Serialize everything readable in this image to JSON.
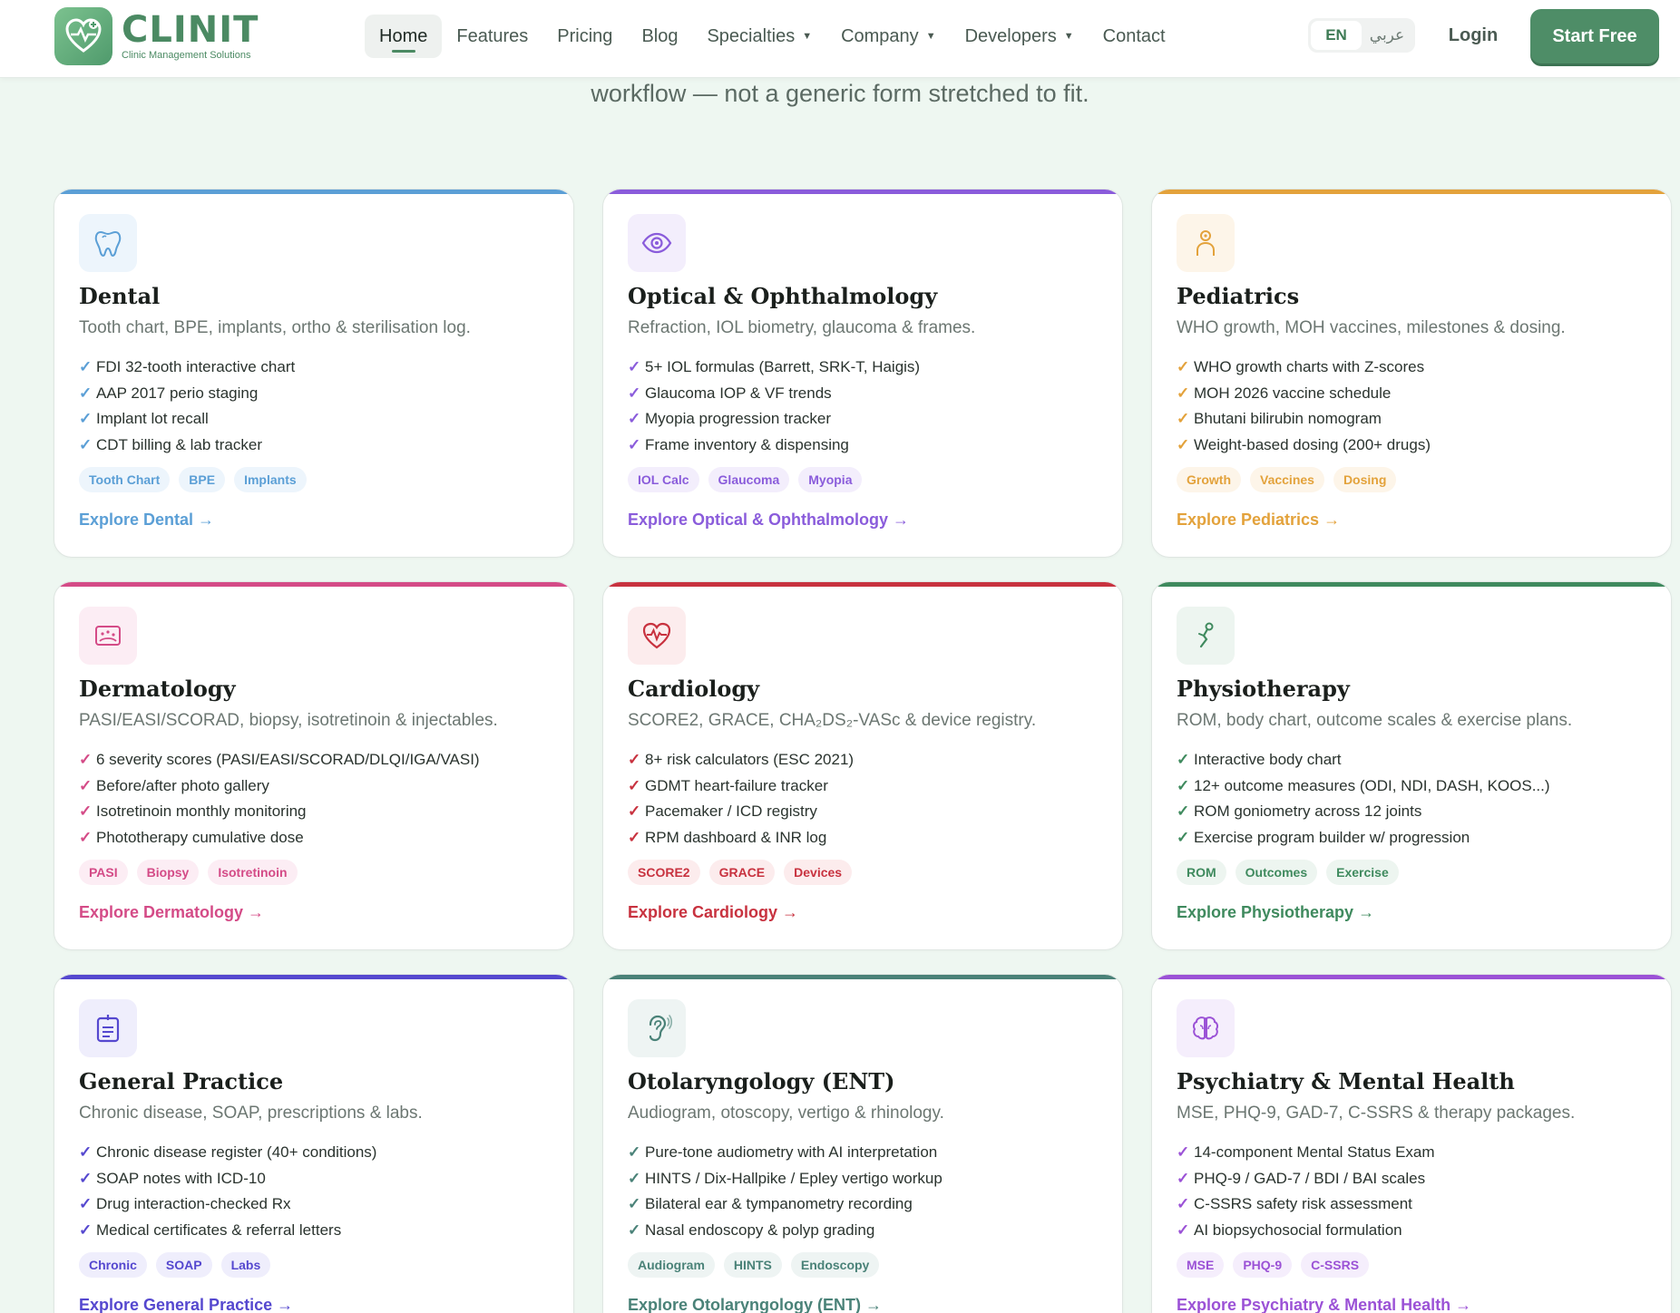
{
  "header": {
    "brand": "CLINIT",
    "tagline": "Clinic Management Solutions",
    "nav": [
      {
        "label": "Home",
        "active": true
      },
      {
        "label": "Features"
      },
      {
        "label": "Pricing"
      },
      {
        "label": "Blog"
      },
      {
        "label": "Specialties",
        "dropdown": true
      },
      {
        "label": "Company",
        "dropdown": true
      },
      {
        "label": "Developers",
        "dropdown": true
      },
      {
        "label": "Contact"
      }
    ],
    "lang_en": "EN",
    "lang_ar": "عربي",
    "login": "Login",
    "cta": "Start Free",
    "caret": "▼"
  },
  "intro": {
    "subline": "workflow — not a generic form stretched to fit."
  },
  "check": "✓",
  "cards": [
    {
      "title": "Dental",
      "icon": "tooth-icon",
      "accent": "#5b9fd6",
      "tint": "#edf5fc",
      "desc": "Tooth chart, BPE, implants, ortho & sterilisation log.",
      "features": [
        "FDI 32-tooth interactive chart",
        "AAP 2017 perio staging",
        "Implant lot recall",
        "CDT billing & lab tracker"
      ],
      "chips": [
        "Tooth Chart",
        "BPE",
        "Implants"
      ],
      "explore": "Explore Dental →"
    },
    {
      "title": "Optical & Ophthalmology",
      "icon": "eye-icon",
      "accent": "#8a5cdb",
      "tint": "#f3eefc",
      "desc": "Refraction, IOL biometry, glaucoma & frames.",
      "features": [
        "5+ IOL formulas (Barrett, SRK-T, Haigis)",
        "Glaucoma IOP & VF trends",
        "Myopia progression tracker",
        "Frame inventory & dispensing"
      ],
      "chips": [
        "IOL Calc",
        "Glaucoma",
        "Myopia"
      ],
      "explore": "Explore Optical & Ophthalmology →"
    },
    {
      "title": "Pediatrics",
      "icon": "child-icon",
      "accent": "#e3a23b",
      "tint": "#fdf5e9",
      "desc": "WHO growth, MOH vaccines, milestones & dosing.",
      "features": [
        "WHO growth charts with Z-scores",
        "MOH 2026 vaccine schedule",
        "Bhutani bilirubin nomogram",
        "Weight-based dosing (200+ drugs)"
      ],
      "chips": [
        "Growth",
        "Vaccines",
        "Dosing"
      ],
      "explore": "Explore Pediatrics →"
    },
    {
      "title": "Dermatology",
      "icon": "skin-icon",
      "accent": "#d44b87",
      "tint": "#fcedf4",
      "desc": "PASI/EASI/SCORAD, biopsy, isotretinoin & injectables.",
      "features": [
        "6 severity scores (PASI/EASI/SCORAD/DLQI/IGA/VASI)",
        "Before/after photo gallery",
        "Isotretinoin monthly monitoring",
        "Phototherapy cumulative dose"
      ],
      "chips": [
        "PASI",
        "Biopsy",
        "Isotretinoin"
      ],
      "explore": "Explore Dermatology →"
    },
    {
      "title": "Cardiology",
      "icon": "heart-pulse-icon",
      "accent": "#c8323f",
      "tint": "#fceced",
      "desc": "SCORE2, GRACE, CHA₂DS₂-VASc & device registry.",
      "features": [
        "8+ risk calculators (ESC 2021)",
        "GDMT heart-failure tracker",
        "Pacemaker / ICD registry",
        "RPM dashboard & INR log"
      ],
      "chips": [
        "SCORE2",
        "GRACE",
        "Devices"
      ],
      "explore": "Explore Cardiology →"
    },
    {
      "title": "Physiotherapy",
      "icon": "joint-icon",
      "accent": "#3f8a5e",
      "tint": "#edf5f0",
      "desc": "ROM, body chart, outcome scales & exercise plans.",
      "features": [
        "Interactive body chart",
        "12+ outcome measures (ODI, NDI, DASH, KOOS...)",
        "ROM goniometry across 12 joints",
        "Exercise program builder w/ progression"
      ],
      "chips": [
        "ROM",
        "Outcomes",
        "Exercise"
      ],
      "explore": "Explore Physiotherapy →"
    },
    {
      "title": "General Practice",
      "icon": "clipboard-icon",
      "accent": "#5548cf",
      "tint": "#efeefc",
      "desc": "Chronic disease, SOAP, prescriptions & labs.",
      "features": [
        "Chronic disease register (40+ conditions)",
        "SOAP notes with ICD-10",
        "Drug interaction-checked Rx",
        "Medical certificates & referral letters"
      ],
      "chips": [
        "Chronic",
        "SOAP",
        "Labs"
      ],
      "explore": "Explore General Practice →"
    },
    {
      "title": "Otolaryngology (ENT)",
      "icon": "ear-icon",
      "accent": "#4a8278",
      "tint": "#eef4f3",
      "desc": "Audiogram, otoscopy, vertigo & rhinology.",
      "features": [
        "Pure-tone audiometry with AI interpretation",
        "HINTS / Dix-Hallpike / Epley vertigo workup",
        "Bilateral ear & tympanometry recording",
        "Nasal endoscopy & polyp grading"
      ],
      "chips": [
        "Audiogram",
        "HINTS",
        "Endoscopy"
      ],
      "explore": "Explore Otolaryngology (ENT) →"
    },
    {
      "title": "Psychiatry & Mental Health",
      "icon": "brain-icon",
      "accent": "#9b52d6",
      "tint": "#f5eefc",
      "desc": "MSE, PHQ-9, GAD-7, C-SSRS & therapy packages.",
      "features": [
        "14-component Mental Status Exam",
        "PHQ-9 / GAD-7 / BDI / BAI scales",
        "C-SSRS safety risk assessment",
        "AI biopsychosocial formulation"
      ],
      "chips": [
        "MSE",
        "PHQ-9",
        "C-SSRS"
      ],
      "explore": "Explore Psychiatry & Mental Health →"
    }
  ]
}
